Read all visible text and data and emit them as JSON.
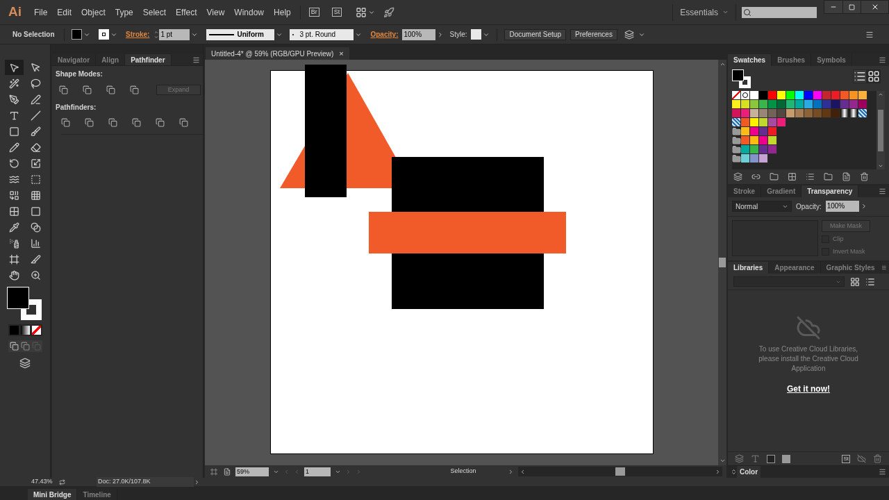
{
  "app": {
    "logo": "Ai",
    "menu": [
      "File",
      "Edit",
      "Object",
      "Type",
      "Select",
      "Effect",
      "View",
      "Window",
      "Help"
    ],
    "bridge": "Br",
    "stock": "St",
    "workspace": "Essentials"
  },
  "control_bar": {
    "selection": "No Selection",
    "stroke_label": "Stroke:",
    "stroke_weight": "1 pt",
    "profile": "Uniform",
    "brush": "3 pt. Round",
    "opacity_label": "Opacity:",
    "opacity": "100%",
    "style_label": "Style:",
    "buttons": [
      "Document Setup",
      "Preferences"
    ]
  },
  "tools": [
    {
      "kind": "selection",
      "selected": true
    },
    {
      "kind": "direct",
      "selected": false
    },
    {
      "kind": "wand",
      "selected": false
    },
    {
      "kind": "lasso",
      "selected": false
    },
    {
      "kind": "pen",
      "selected": false
    },
    {
      "kind": "curvature",
      "selected": false
    },
    {
      "kind": "type",
      "selected": false
    },
    {
      "kind": "line",
      "selected": false
    },
    {
      "kind": "rect",
      "selected": false
    },
    {
      "kind": "brush",
      "selected": false
    },
    {
      "kind": "pencil",
      "selected": false
    },
    {
      "kind": "eraser",
      "selected": false
    },
    {
      "kind": "rotate",
      "selected": false
    },
    {
      "kind": "scale",
      "selected": false
    },
    {
      "kind": "warp",
      "selected": false
    },
    {
      "kind": "free",
      "selected": false
    },
    {
      "kind": "builder",
      "selected": false
    },
    {
      "kind": "perspective",
      "selected": false
    },
    {
      "kind": "mesh",
      "selected": false
    },
    {
      "kind": "gradient",
      "selected": false
    },
    {
      "kind": "eyedropper",
      "selected": false
    },
    {
      "kind": "blend",
      "selected": false
    },
    {
      "kind": "spray",
      "selected": false
    },
    {
      "kind": "graph",
      "selected": false
    },
    {
      "kind": "artboard",
      "selected": false
    },
    {
      "kind": "slice",
      "selected": false
    },
    {
      "kind": "hand",
      "selected": false
    },
    {
      "kind": "zoom",
      "selected": false
    }
  ],
  "pathfinder_panel": {
    "tabs": [
      {
        "label": "Navigator",
        "selected": false
      },
      {
        "label": "Align",
        "selected": false
      },
      {
        "label": "Pathfinder",
        "selected": true
      }
    ],
    "shape_modes_label": "Shape Modes:",
    "expand": "Expand",
    "expand_disabled": true,
    "pathfinders_label": "Pathfinders:"
  },
  "document": {
    "tab": "Untitled-4* @ 59% (RGB/GPU Preview)",
    "close": "×"
  },
  "status_bar": {
    "zoom": "59%",
    "artboard": "1",
    "tool": "Selection"
  },
  "bottom": {
    "zoom_reading": "47.43%",
    "doc_info": "Doc: 27.0K/107.8K",
    "tabs": [
      {
        "label": "Mini Bridge",
        "selected": true
      },
      {
        "label": "Timeline",
        "selected": false
      }
    ]
  },
  "swatches_panel": {
    "tabs": [
      {
        "label": "Swatches",
        "selected": true
      },
      {
        "label": "Brushes",
        "selected": false
      },
      {
        "label": "Symbols",
        "selected": false
      }
    ],
    "rows": [
      [
        {
          "kind": "none"
        },
        {
          "kind": "registration"
        },
        {
          "kind": "color",
          "color": "#ffffff"
        },
        {
          "kind": "color",
          "color": "#000000"
        },
        {
          "kind": "color",
          "color": "#ff0000"
        },
        {
          "kind": "color",
          "color": "#ffff00"
        },
        {
          "kind": "color",
          "color": "#00ff00"
        },
        {
          "kind": "color",
          "color": "#00ffff"
        },
        {
          "kind": "color",
          "color": "#0000ff"
        },
        {
          "kind": "color",
          "color": "#ff00ff"
        },
        {
          "kind": "color",
          "color": "#c1272d"
        },
        {
          "kind": "color",
          "color": "#ed1c24"
        },
        {
          "kind": "color",
          "color": "#f15a24"
        },
        {
          "kind": "color",
          "color": "#f7931e"
        },
        {
          "kind": "color",
          "color": "#fbb03b"
        }
      ],
      [
        {
          "kind": "color",
          "color": "#fcee21"
        },
        {
          "kind": "color",
          "color": "#d9e021"
        },
        {
          "kind": "color",
          "color": "#8cc63f"
        },
        {
          "kind": "color",
          "color": "#39b54a"
        },
        {
          "kind": "color",
          "color": "#009245"
        },
        {
          "kind": "color",
          "color": "#006837"
        },
        {
          "kind": "color",
          "color": "#22b573"
        },
        {
          "kind": "color",
          "color": "#00a99d"
        },
        {
          "kind": "color",
          "color": "#29abe2"
        },
        {
          "kind": "color",
          "color": "#0071bc"
        },
        {
          "kind": "color",
          "color": "#2e3192"
        },
        {
          "kind": "color",
          "color": "#1b1464"
        },
        {
          "kind": "color",
          "color": "#662d91"
        },
        {
          "kind": "color",
          "color": "#93278f"
        },
        {
          "kind": "color",
          "color": "#9e005d"
        }
      ],
      [
        {
          "kind": "color",
          "color": "#d4145a"
        },
        {
          "kind": "color",
          "color": "#ed1e79"
        },
        {
          "kind": "color",
          "color": "#c7b299"
        },
        {
          "kind": "color",
          "color": "#998675"
        },
        {
          "kind": "color",
          "color": "#736357"
        },
        {
          "kind": "color",
          "color": "#534741"
        },
        {
          "kind": "color",
          "color": "#c69c6d"
        },
        {
          "kind": "color",
          "color": "#a67c52"
        },
        {
          "kind": "color",
          "color": "#8c6239"
        },
        {
          "kind": "color",
          "color": "#754c24"
        },
        {
          "kind": "color",
          "color": "#603813"
        },
        {
          "kind": "color",
          "color": "#42210b"
        },
        {
          "kind": "gradient"
        },
        {
          "kind": "gradient"
        },
        {
          "kind": "pattern"
        }
      ],
      [
        {
          "kind": "pattern"
        },
        {
          "kind": "color",
          "color": "#f15a24"
        },
        {
          "kind": "color",
          "color": "#fff200"
        },
        {
          "kind": "color",
          "color": "#c1d82f"
        },
        {
          "kind": "color",
          "color": "#a54ca0"
        },
        {
          "kind": "color",
          "color": "#ed1e79"
        }
      ],
      [
        {
          "kind": "group"
        },
        {
          "kind": "color",
          "color": "#fbbc15"
        },
        {
          "kind": "color",
          "color": "#ec008c"
        },
        {
          "kind": "color",
          "color": "#662d91"
        },
        {
          "kind": "color",
          "color": "#ed1c24"
        }
      ],
      [
        {
          "kind": "group"
        },
        {
          "kind": "color",
          "color": "#f15a24"
        },
        {
          "kind": "color",
          "color": "#fbbc15"
        },
        {
          "kind": "color",
          "color": "#ec008c"
        },
        {
          "kind": "color",
          "color": "#c1d82f"
        }
      ],
      [
        {
          "kind": "group"
        },
        {
          "kind": "color",
          "color": "#00a99d"
        },
        {
          "kind": "color",
          "color": "#39b54a"
        },
        {
          "kind": "color",
          "color": "#662d91"
        },
        {
          "kind": "color",
          "color": "#92278f"
        }
      ],
      [
        {
          "kind": "group"
        },
        {
          "kind": "color",
          "color": "#6dcfd6"
        },
        {
          "kind": "color",
          "color": "#8493ca"
        },
        {
          "kind": "color",
          "color": "#c7a3d4"
        }
      ]
    ]
  },
  "transparency_panel": {
    "tabs": [
      {
        "label": "Stroke",
        "selected": false
      },
      {
        "label": "Gradient",
        "selected": false
      },
      {
        "label": "Transparency",
        "selected": true
      }
    ],
    "blend_mode": "Normal",
    "opacity_label": "Opacity:",
    "opacity": "100%",
    "make_mask": "Make Mask",
    "options": [
      {
        "label": "Clip",
        "checked": false
      },
      {
        "label": "Invert Mask",
        "checked": false
      }
    ]
  },
  "libraries_panel": {
    "tabs": [
      {
        "label": "Libraries",
        "selected": true
      },
      {
        "label": "Appearance",
        "selected": false
      },
      {
        "label": "Graphic Styles",
        "selected": false
      }
    ],
    "message": "To use Creative Cloud Libraries, please install the Creative Cloud Application",
    "link": "Get it now!",
    "stock_label": "St"
  },
  "color_panel": {
    "tab": "Color"
  }
}
